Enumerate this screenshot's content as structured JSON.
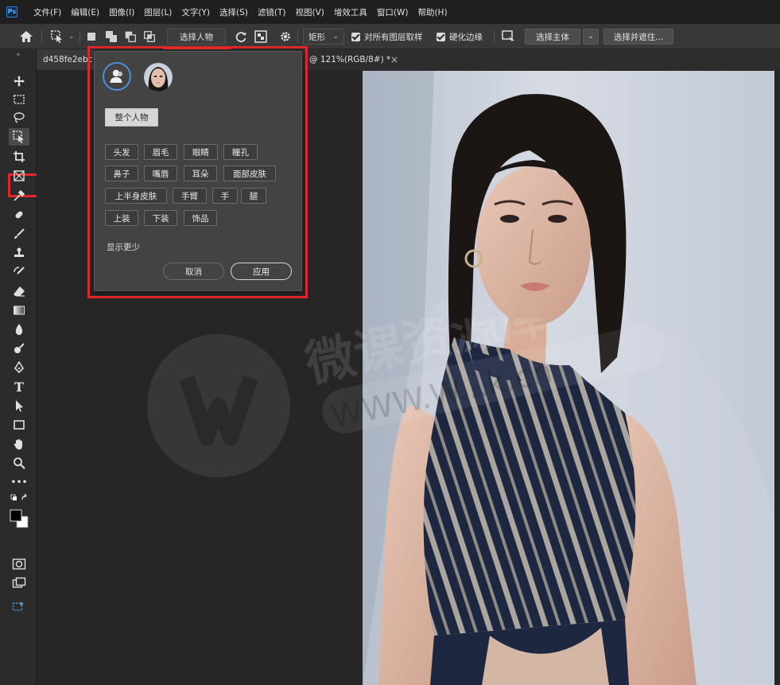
{
  "menubar": {
    "logo": "Ps",
    "items": [
      "文件(F)",
      "编辑(E)",
      "图像(I)",
      "图层(L)",
      "文字(Y)",
      "选择(S)",
      "滤镜(T)",
      "视图(V)",
      "增效工具",
      "窗口(W)",
      "帮助(H)"
    ]
  },
  "options": {
    "select_people_button": "选择人物",
    "shape_mode": "矩形",
    "sample_all_layers": "对所有图层取样",
    "hard_edge": "硬化边缘",
    "select_subject": "选择主体",
    "select_and_mask": "选择并遮住..."
  },
  "tabs": {
    "doc1": "d458fe2ebc",
    "doc2": "@ 121%(RGB/8#) *",
    "close": "×"
  },
  "panel": {
    "whole_person": "整个人物",
    "parts_row1": [
      "头发",
      "眉毛",
      "眼睛",
      "瞳孔"
    ],
    "parts_row2": [
      "鼻子",
      "嘴唇",
      "耳朵",
      "面部皮肤"
    ],
    "parts_row3": [
      "上半身皮肤",
      "手臂",
      "手",
      "腿"
    ],
    "parts_row4": [
      "上装",
      "下装",
      "饰品"
    ],
    "show_less": "显示更少",
    "cancel": "取消",
    "apply": "应用"
  },
  "watermark": {
    "text": "微课资源库",
    "url": "WWW.W...k.cn"
  },
  "colors": {
    "highlight": "#e0262a",
    "ui_dark": "#2b2b2b",
    "panel": "#434343"
  }
}
